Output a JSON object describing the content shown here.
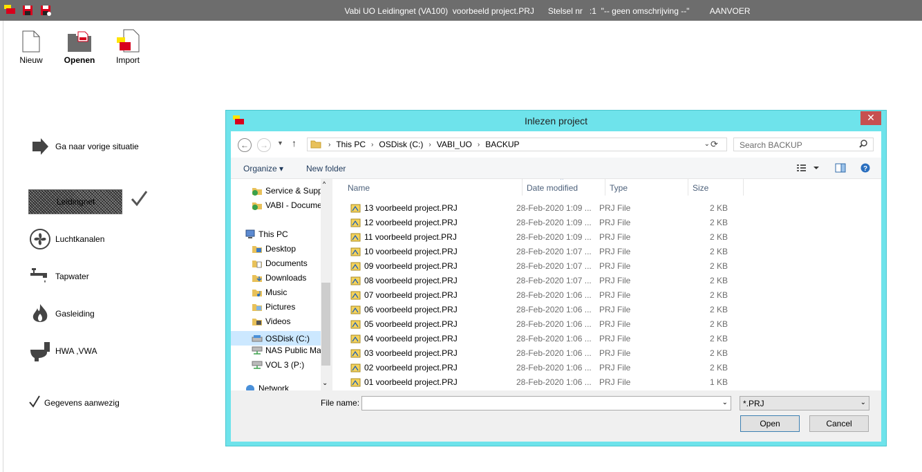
{
  "app": {
    "title": "Vabi UO Leidingnet (VA100)  voorbeeld project.PRJ      Stelsel nr   :1  \"-- geen omschrijving --\"         AANVOER"
  },
  "ribbon": {
    "new_label": "Nieuw",
    "open_label": "Openen",
    "import_label": "Import"
  },
  "sidebar": {
    "back_label": "Ga naar vorige situatie",
    "leidingnet_label": "Leidingnet",
    "items": [
      {
        "label": "Luchtkanalen",
        "icon": "fan-icon"
      },
      {
        "label": "Tapwater",
        "icon": "faucet-icon"
      },
      {
        "label": "Gasleiding",
        "icon": "flame-icon"
      },
      {
        "label": "HWA ,VWA",
        "icon": "toilet-icon"
      }
    ],
    "data_present_label": "Gegevens aanwezig"
  },
  "dialog": {
    "title": "Inlezen project",
    "close_glyph": "✕",
    "address": [
      "This PC",
      "OSDisk (C:)",
      "VABI_UO",
      "BACKUP"
    ],
    "search_placeholder": "Search BACKUP",
    "organize_label": "Organize ▾",
    "new_folder_label": "New folder",
    "nav": [
      {
        "label": "Service & Supp",
        "level": 2
      },
      {
        "label": "VABI - Docume",
        "level": 2
      },
      {
        "label": "This PC",
        "level": 1
      },
      {
        "label": "Desktop",
        "level": 2
      },
      {
        "label": "Documents",
        "level": 2
      },
      {
        "label": "Downloads",
        "level": 2
      },
      {
        "label": "Music",
        "level": 2
      },
      {
        "label": "Pictures",
        "level": 2
      },
      {
        "label": "Videos",
        "level": 2
      },
      {
        "label": "OSDisk (C:)",
        "level": 2,
        "selected": true
      },
      {
        "label": "NAS Public Ma",
        "level": 2
      },
      {
        "label": "VOL 3 (P:)",
        "level": 2
      },
      {
        "label": "Network",
        "level": 1
      }
    ],
    "columns": {
      "name": "Name",
      "date": "Date modified",
      "type": "Type",
      "size": "Size"
    },
    "files": [
      {
        "name": "13 voorbeeld project.PRJ",
        "date": "28-Feb-2020 1:09 ...",
        "type": "PRJ File",
        "size": "2 KB"
      },
      {
        "name": "12 voorbeeld project.PRJ",
        "date": "28-Feb-2020 1:09 ...",
        "type": "PRJ File",
        "size": "2 KB"
      },
      {
        "name": "11 voorbeeld project.PRJ",
        "date": "28-Feb-2020 1:09 ...",
        "type": "PRJ File",
        "size": "2 KB"
      },
      {
        "name": "10 voorbeeld project.PRJ",
        "date": "28-Feb-2020 1:07 ...",
        "type": "PRJ File",
        "size": "2 KB"
      },
      {
        "name": "09 voorbeeld project.PRJ",
        "date": "28-Feb-2020 1:07 ...",
        "type": "PRJ File",
        "size": "2 KB"
      },
      {
        "name": "08 voorbeeld project.PRJ",
        "date": "28-Feb-2020 1:07 ...",
        "type": "PRJ File",
        "size": "2 KB"
      },
      {
        "name": "07 voorbeeld project.PRJ",
        "date": "28-Feb-2020 1:06 ...",
        "type": "PRJ File",
        "size": "2 KB"
      },
      {
        "name": "06 voorbeeld project.PRJ",
        "date": "28-Feb-2020 1:06 ...",
        "type": "PRJ File",
        "size": "2 KB"
      },
      {
        "name": "05 voorbeeld project.PRJ",
        "date": "28-Feb-2020 1:06 ...",
        "type": "PRJ File",
        "size": "2 KB"
      },
      {
        "name": "04 voorbeeld project.PRJ",
        "date": "28-Feb-2020 1:06 ...",
        "type": "PRJ File",
        "size": "2 KB"
      },
      {
        "name": "03 voorbeeld project.PRJ",
        "date": "28-Feb-2020 1:06 ...",
        "type": "PRJ File",
        "size": "2 KB"
      },
      {
        "name": "02 voorbeeld project.PRJ",
        "date": "28-Feb-2020 1:06 ...",
        "type": "PRJ File",
        "size": "2 KB"
      },
      {
        "name": "01 voorbeeld project.PRJ",
        "date": "28-Feb-2020 1:06 ...",
        "type": "PRJ File",
        "size": "1 KB"
      }
    ],
    "filename_label": "File name:",
    "filename_value": "",
    "filetype_value": "*.PRJ",
    "open_label": "Open",
    "cancel_label": "Cancel"
  },
  "colors": {
    "titlebar": "#6d6d6d",
    "dialog_frame": "#6ee3eb",
    "close_button": "#c75050",
    "brand_red": "#d8001c",
    "brand_yellow": "#ffe400"
  }
}
